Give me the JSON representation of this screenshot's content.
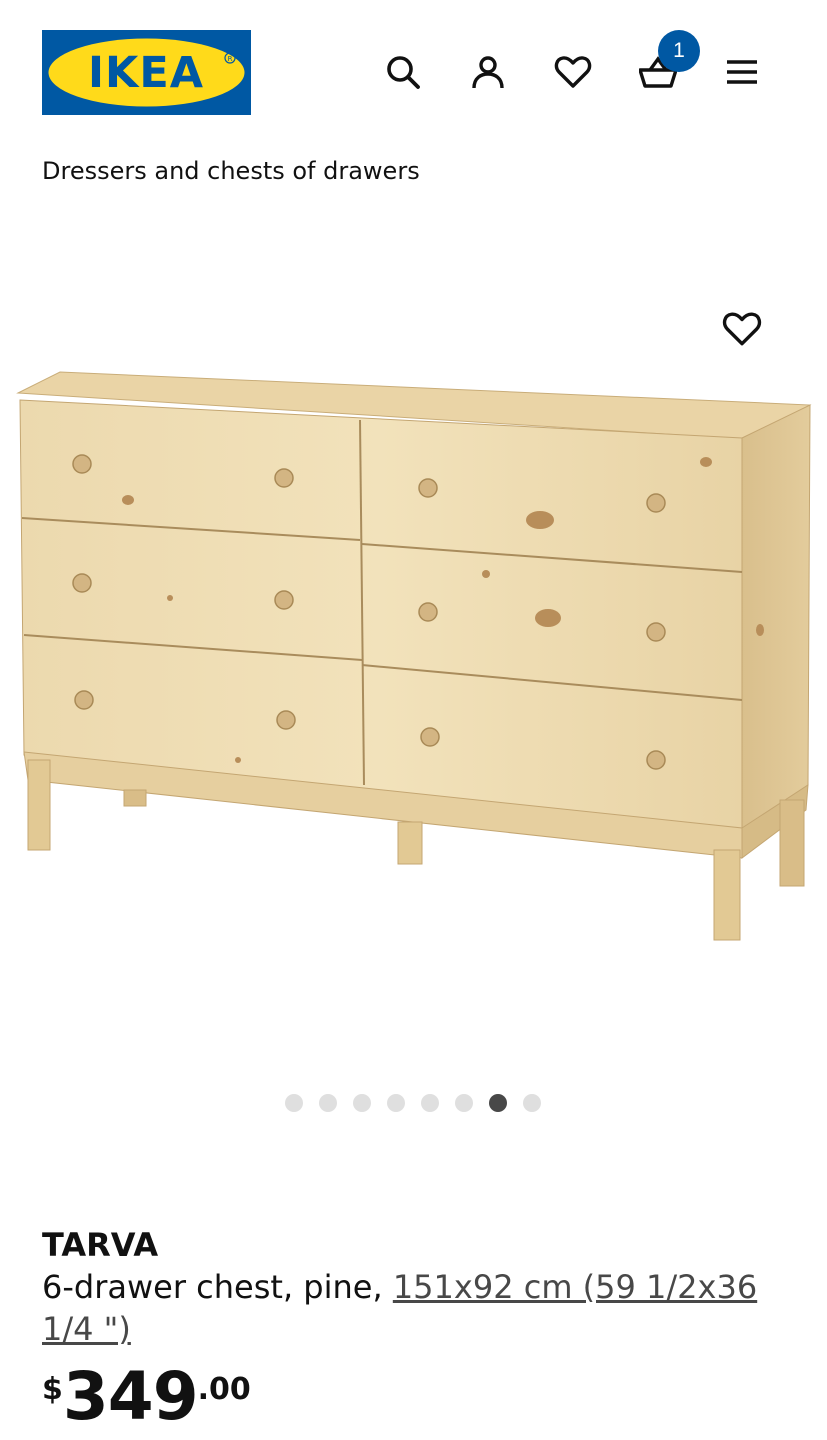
{
  "header": {
    "logo_text": "IKEA",
    "cart_count": "1",
    "brand_blue": "#0058a3",
    "brand_yellow": "#ffda1a"
  },
  "icons": [
    "search-icon",
    "account-icon",
    "wishlist-heart-icon",
    "cart-basket-icon",
    "menu-icon"
  ],
  "breadcrumb": "Dressers and chests of drawers",
  "gallery": {
    "dot_count": 8,
    "active_index": 6
  },
  "product": {
    "name": "TARVA",
    "description": "6-drawer chest, pine, ",
    "size_link": "151x92 cm (59 1/2x36 1/4 \")",
    "price_currency": "$",
    "price_int": "349",
    "price_dec": ".00"
  }
}
